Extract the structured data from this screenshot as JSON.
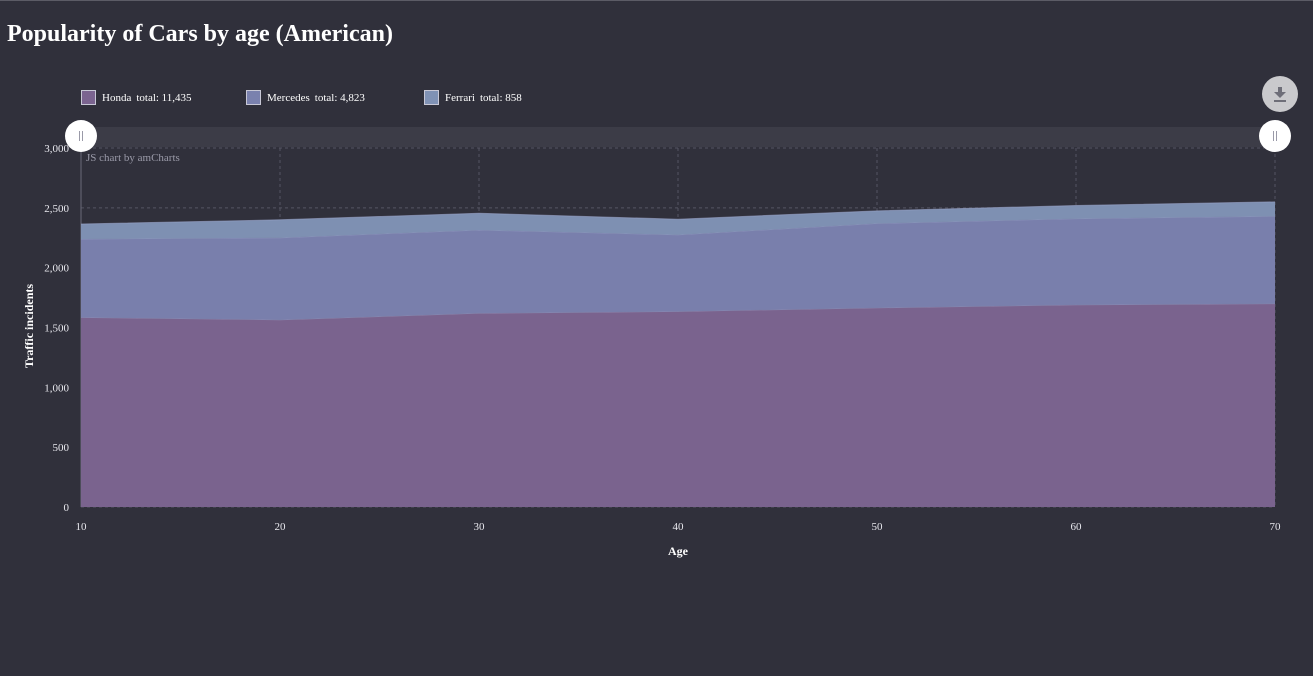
{
  "page": {
    "title": "Popularity of Cars by age (American)",
    "credit": "JS chart by amCharts"
  },
  "colors": {
    "background": "#30303b",
    "honda": "#7b6490",
    "mercedes": "#7a81ae",
    "ferrari": "#8092b5"
  },
  "icons": {
    "export": "download-icon",
    "scrollbar_grip": "grip-icon"
  },
  "legend": [
    {
      "name": "Honda",
      "total_label": "total: 11,435",
      "color": "#7b6490"
    },
    {
      "name": "Mercedes",
      "total_label": "total: 4,823",
      "color": "#7a81ae"
    },
    {
      "name": "Ferrari",
      "total_label": "total: 858",
      "color": "#8092b5"
    }
  ],
  "chart_data": {
    "type": "area",
    "stacked": true,
    "title": "Popularity of Cars by age (American)",
    "xlabel": "Age",
    "ylabel": "Traffic incidents",
    "x": [
      10,
      20,
      30,
      40,
      50,
      60,
      70
    ],
    "x_tick_labels": [
      "10",
      "20",
      "30",
      "40",
      "50",
      "60",
      "70"
    ],
    "ylim": [
      0,
      3000
    ],
    "y_tick_values": [
      0,
      500,
      1000,
      1500,
      2000,
      2500,
      3000
    ],
    "y_tick_labels": [
      "0",
      "500",
      "1,000",
      "1,500",
      "2,000",
      "2,500",
      "3,000"
    ],
    "grid": true,
    "legend_position": "top-left",
    "series": [
      {
        "name": "Honda",
        "values": [
          1585,
          1565,
          1620,
          1635,
          1665,
          1690,
          1700
        ]
      },
      {
        "name": "Mercedes",
        "values": [
          655,
          685,
          695,
          640,
          705,
          720,
          730
        ]
      },
      {
        "name": "Ferrari",
        "values": [
          125,
          150,
          140,
          130,
          105,
          110,
          120
        ]
      }
    ]
  }
}
